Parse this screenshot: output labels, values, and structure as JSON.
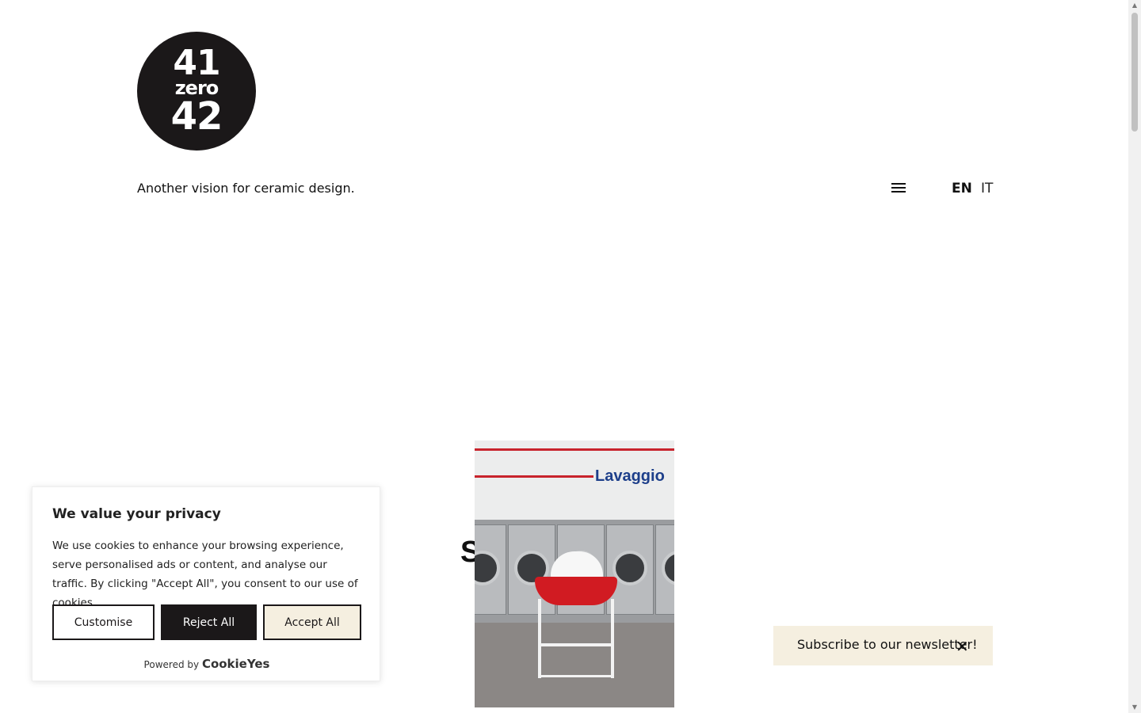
{
  "brand": {
    "logo_line1": "41",
    "logo_line2": "zero",
    "logo_line3": "42",
    "tagline": "Another vision for ceramic design."
  },
  "header": {
    "menu_icon": "hamburger-menu-icon",
    "languages": [
      "EN",
      "IT"
    ],
    "active_language": "EN"
  },
  "hero": {
    "sign_text": "Lavaggio",
    "overlay_letter": "S"
  },
  "newsletter": {
    "label": "Subscribe to our newsletter!",
    "close_symbol": "✕"
  },
  "cookie": {
    "title": "We value your privacy",
    "body": "We use cookies to enhance your browsing experience, serve personalised ads or content, and analyse our traffic. By clicking \"Accept All\", you consent to our use of cookies.",
    "customise_label": "Customise",
    "reject_label": "Reject All",
    "accept_label": "Accept All",
    "powered_by": "Powered by",
    "powered_brand": "CookieYes"
  },
  "colors": {
    "accent_cream": "#f5efe0",
    "logo_dark": "#1b1819",
    "sign_blue": "#1d3f8a",
    "stripe_red": "#c8232c"
  }
}
